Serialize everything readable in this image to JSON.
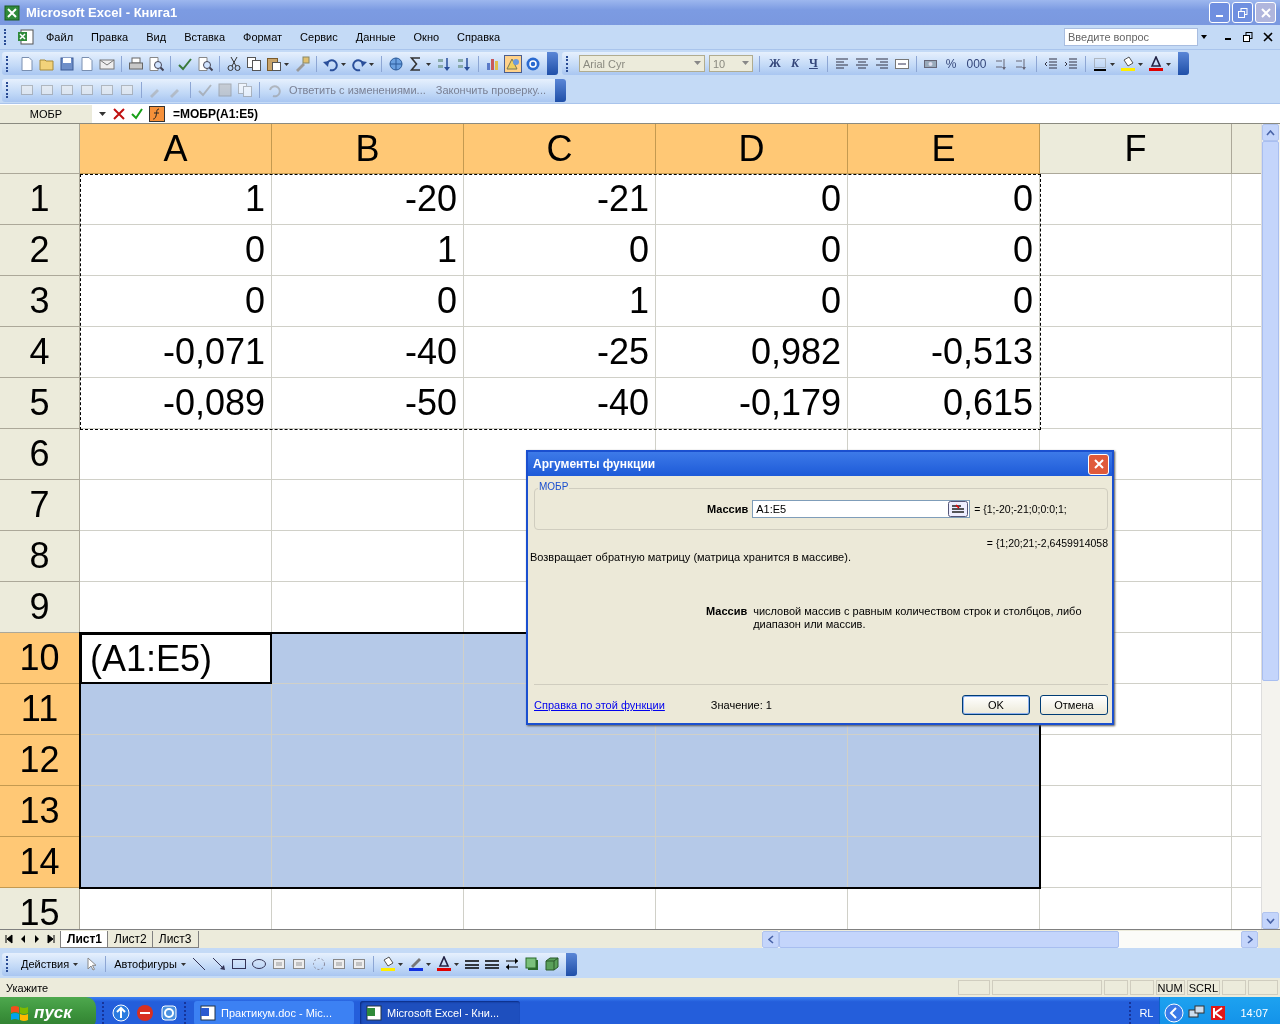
{
  "window": {
    "title": "Microsoft Excel - Книга1"
  },
  "menu": [
    "Файл",
    "Правка",
    "Вид",
    "Вставка",
    "Формат",
    "Сервис",
    "Данные",
    "Окно",
    "Справка"
  ],
  "help_search": {
    "placeholder": "Введите вопрос"
  },
  "formatting": {
    "font": "Arial Cyr",
    "size": "10",
    "style_buttons": [
      "Ж",
      "К",
      "Ч"
    ],
    "number_buttons": [
      "%",
      "000"
    ]
  },
  "reviewing": {
    "reply": "Ответить с изменениями...",
    "finish": "Закончить проверку..."
  },
  "formula_bar": {
    "name_box": "МОБР",
    "formula": "=МОБР(A1:E5)"
  },
  "sheet": {
    "columns": [
      {
        "label": "A",
        "selected": true
      },
      {
        "label": "B",
        "selected": true
      },
      {
        "label": "C",
        "selected": true
      },
      {
        "label": "D",
        "selected": true
      },
      {
        "label": "E",
        "selected": true
      },
      {
        "label": "F",
        "selected": false
      }
    ],
    "rows": [
      {
        "label": "1",
        "selected": false,
        "referenced": true,
        "active": false,
        "cells": [
          "1",
          "-20",
          "-21",
          "0",
          "0"
        ]
      },
      {
        "label": "2",
        "selected": false,
        "referenced": true,
        "active": false,
        "cells": [
          "0",
          "1",
          "0",
          "0",
          "0"
        ]
      },
      {
        "label": "3",
        "selected": false,
        "referenced": true,
        "active": false,
        "cells": [
          "0",
          "0",
          "1",
          "0",
          "0"
        ]
      },
      {
        "label": "4",
        "selected": false,
        "referenced": true,
        "active": false,
        "cells": [
          "-0,071",
          "-40",
          "-25",
          "0,982",
          "-0,513"
        ]
      },
      {
        "label": "5",
        "selected": false,
        "referenced": true,
        "active": false,
        "cells": [
          "-0,089",
          "-50",
          "-40",
          "-0,179",
          "0,615"
        ]
      },
      {
        "label": "6",
        "selected": false,
        "referenced": false,
        "active": false
      },
      {
        "label": "7",
        "selected": false,
        "referenced": false,
        "active": false
      },
      {
        "label": "8",
        "selected": false,
        "referenced": false,
        "active": false
      },
      {
        "label": "9",
        "selected": false,
        "referenced": false,
        "active": false
      },
      {
        "label": "10",
        "selected": true,
        "referenced": false,
        "active": true,
        "cells": [
          "(A1:E5)"
        ]
      },
      {
        "label": "11",
        "selected": true,
        "referenced": false,
        "active": false
      },
      {
        "label": "12",
        "selected": true,
        "referenced": false,
        "active": false
      },
      {
        "label": "13",
        "selected": true,
        "referenced": false,
        "active": false
      },
      {
        "label": "14",
        "selected": true,
        "referenced": false,
        "active": false
      },
      {
        "label": "15",
        "selected": false,
        "referenced": false,
        "active": false
      }
    ]
  },
  "sheet_tabs": [
    {
      "label": "Лист1",
      "selected": true
    },
    {
      "label": "Лист2",
      "selected": false
    },
    {
      "label": "Лист3",
      "selected": false
    }
  ],
  "drawing_toolbar": {
    "actions": "Действия",
    "autoshapes": "Автофигуры"
  },
  "status_bar": {
    "message": "Укажите",
    "indicators": [
      "NUM",
      "SCRL"
    ]
  },
  "taskbar": {
    "start": "пуск",
    "tasks": [
      {
        "label": "Практикум.doc - Mic...",
        "selected": false
      },
      {
        "label": "Microsoft Excel - Кни...",
        "selected": true
      }
    ],
    "language": "RL",
    "clock": "14:07"
  },
  "dialog": {
    "title": "Аргументы функции",
    "function": "МОБР",
    "argument_label": "Массив",
    "argument_value": "A1:E5",
    "argument_result": "= {1;-20;-21;0;0:0;1;",
    "formula_result": "= {1;20;21;-2,6459914058",
    "description": "Возвращает обратную матрицу (матрица хранится в массиве).",
    "help_label": "Массив",
    "help_text": "числовой массив с равным количеством строк и столбцов, либо диапазон или массив.",
    "help_link": "Справка по этой функции",
    "value": "Значение: 1",
    "buttons": [
      "OK",
      "Отмена"
    ]
  }
}
